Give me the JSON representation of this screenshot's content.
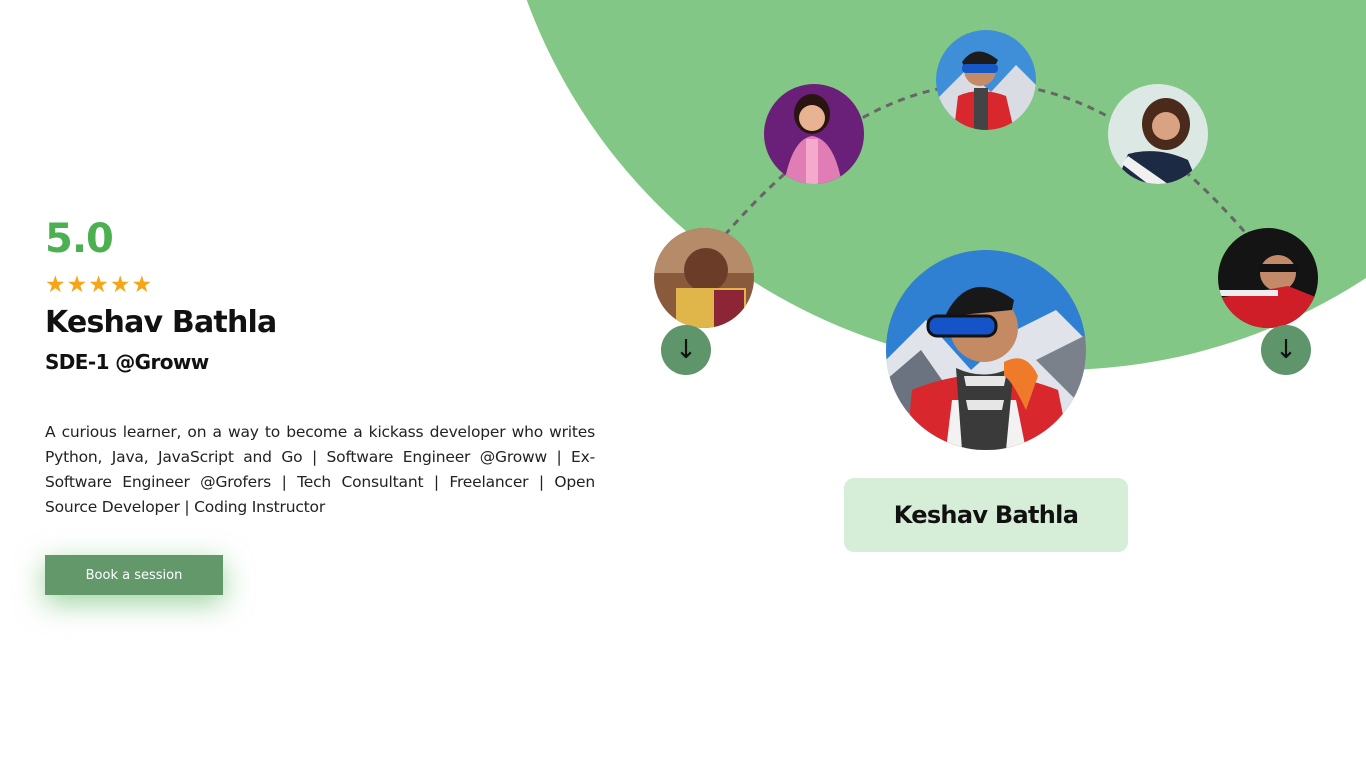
{
  "profile": {
    "rating": "5.0",
    "stars": [
      "★",
      "★",
      "★",
      "★",
      "★"
    ],
    "name": "Keshav Bathla",
    "role": "SDE-1 @Groww",
    "bio": "A curious learner, on a way to become a kickass developer who writes Python, Java, JavaScript and Go | Software Engineer @Groww | Ex-Software Engineer @Grofers | Tech Consultant | Freelancer | Open Source Developer | Coding Instructor",
    "book_label": "Book a session",
    "rating_value": 5
  },
  "carousel": {
    "selected_name": "Keshav Bathla",
    "prev_icon": "↓",
    "next_icon": "↓",
    "avatars": [
      {
        "id": "mentor-1"
      },
      {
        "id": "mentor-2"
      },
      {
        "id": "mentor-3"
      },
      {
        "id": "mentor-4"
      },
      {
        "id": "mentor-5"
      }
    ]
  },
  "colors": {
    "accent": "#4caf50",
    "blob": "#82c785",
    "button": "#63996a",
    "star": "#f5a516",
    "card": "#d6eed7"
  }
}
